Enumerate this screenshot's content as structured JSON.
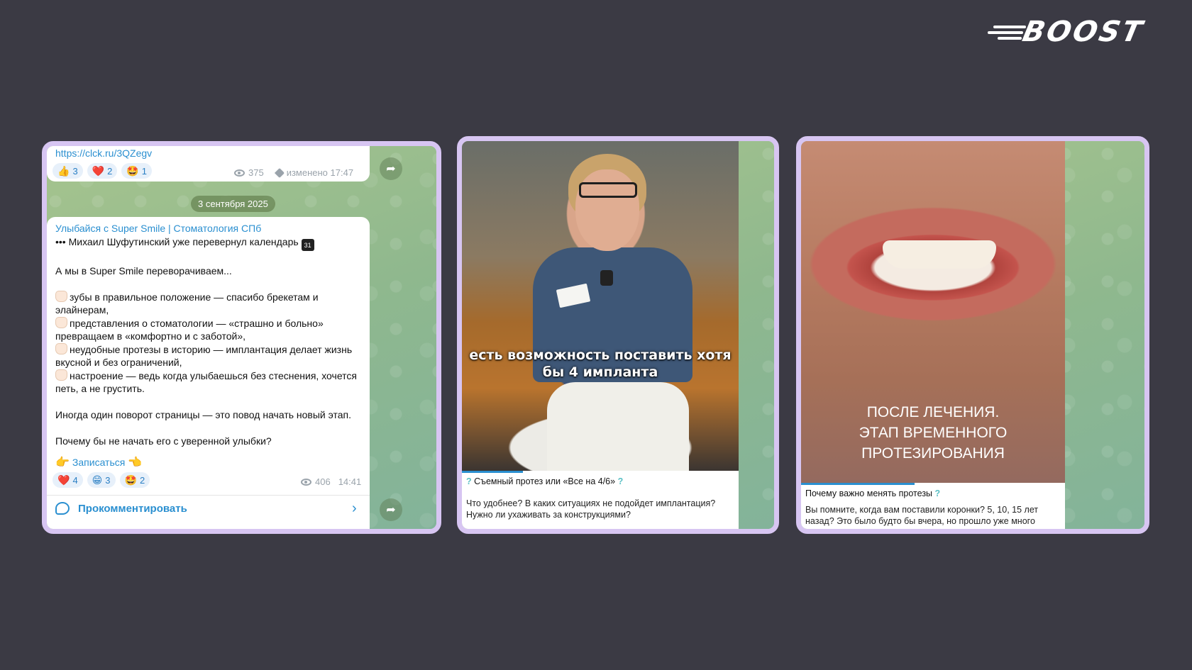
{
  "brand": {
    "logo_text": "BOOST"
  },
  "card1": {
    "top_link": "https://clck.ru/3QZegv",
    "top_reactions": [
      {
        "emoji": "👍",
        "count": "3"
      },
      {
        "emoji": "❤️",
        "count": "2"
      },
      {
        "emoji": "🤩",
        "count": "1"
      }
    ],
    "top_views": "375",
    "top_edited": "изменено 17:47",
    "date": "3 сентября 2025",
    "channel": "Улыбайся с Super Smile | Стоматология СПб",
    "line1": "Михаил Шуфутинский уже перевернул календарь",
    "line2": "А мы в Super Smile переворачиваем...",
    "bullet1": "зубы в правильное положение — спасибо брекетам и элайнерам,",
    "bullet2": "представления о стоматологии — «страшно и больно» превращаем в «комфортно и с заботой»,",
    "bullet3": "неудобные протезы в историю — имплантация делает жизнь вкусной и без ограничений,",
    "bullet4": "настроение — ведь когда улыбаешься без стеснения, хочется петь, а не грустить.",
    "line3": "Иногда один поворот страницы — это повод начать новый этап.",
    "line4": "Почему бы не начать его с уверенной улыбки?",
    "book_link": "Записаться",
    "reactions": [
      {
        "emoji": "❤️",
        "count": "4"
      },
      {
        "emoji": "😁",
        "count": "3"
      },
      {
        "emoji": "🤩",
        "count": "2"
      }
    ],
    "views": "406",
    "time": "14:41",
    "comment_label": "Прокомментировать"
  },
  "card2": {
    "caption": "есть возможность поставить хотя бы 4 импланта",
    "title": "Съемный протез или «Все на 4/6»",
    "text": "Что удобнее? В каких ситуациях не подойдет имплантация? Нужно ли ухаживать за конструкциями?",
    "progress": 0.22
  },
  "card3": {
    "caption": "ПОСЛЕ ЛЕЧЕНИЯ.\nЭТАП ВРЕМЕННОГО\nПРОТЕЗИРОВАНИЯ",
    "caption_lines": [
      "ПОСЛЕ ЛЕЧЕНИЯ.",
      "ЭТАП ВРЕМЕННОГО",
      "ПРОТЕЗИРОВАНИЯ"
    ],
    "title": "Почему важно менять протезы",
    "text": "Вы помните, когда вам поставили коронки? 5, 10, 15 лет назад? Это было будто бы вчера, но прошло уже много времени. Вдруг",
    "progress": 0.43
  }
}
